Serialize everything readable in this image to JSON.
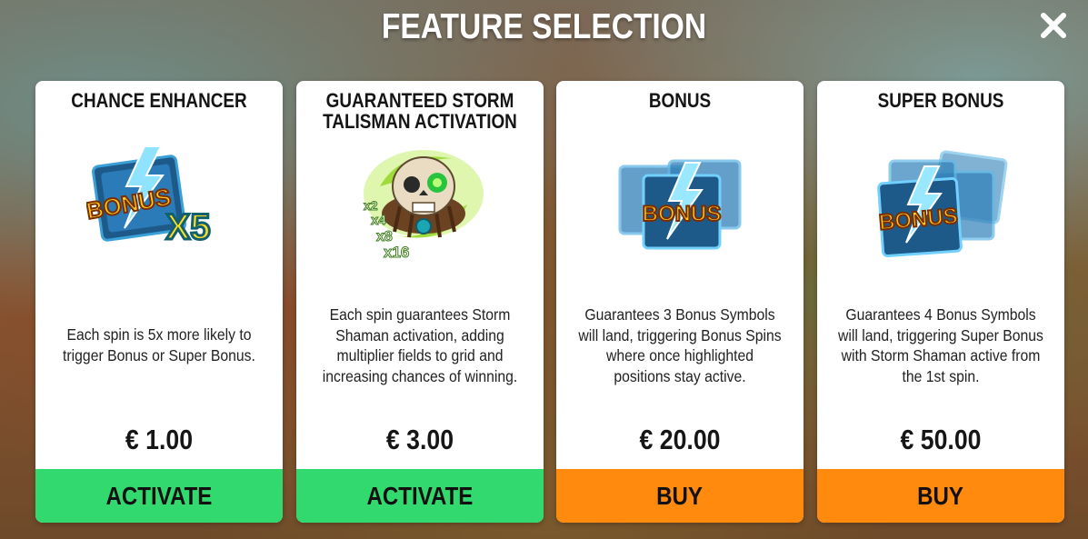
{
  "header": {
    "title": "FEATURE SELECTION"
  },
  "colors": {
    "activate": "#32d96f",
    "buy": "#ff8a0d"
  },
  "cards": [
    {
      "title": "CHANCE ENHANCER",
      "icon": "bonus-x5-icon",
      "description": "Each spin is 5x more likely to trigger Bonus or Super Bonus.",
      "price": "€ 1.00",
      "action": "ACTIVATE",
      "art_text": "BONUS",
      "art_multiplier": "X5"
    },
    {
      "title": "GUARANTEED STORM TALISMAN ACTIVATION",
      "icon": "skull-talisman-icon",
      "description": "Each spin guarantees Storm Shaman activation, adding multiplier fields to grid and increasing chances of winning.",
      "price": "€ 3.00",
      "action": "ACTIVATE",
      "art_multipliers": [
        "x2",
        "x4",
        "x8",
        "x16"
      ]
    },
    {
      "title": "BONUS",
      "icon": "bonus-cards-icon",
      "description": "Guarantees 3 Bonus Symbols will land, triggering Bonus Spins where once highlighted positions stay active.",
      "price": "€ 20.00",
      "action": "BUY",
      "art_text": "BONUS"
    },
    {
      "title": "SUPER BONUS",
      "icon": "super-bonus-cards-icon",
      "description": "Guarantees 4 Bonus Symbols will land, triggering Super Bonus with Storm Shaman active from the 1st spin.",
      "price": "€ 50.00",
      "action": "BUY",
      "art_text": "BONUS"
    }
  ]
}
